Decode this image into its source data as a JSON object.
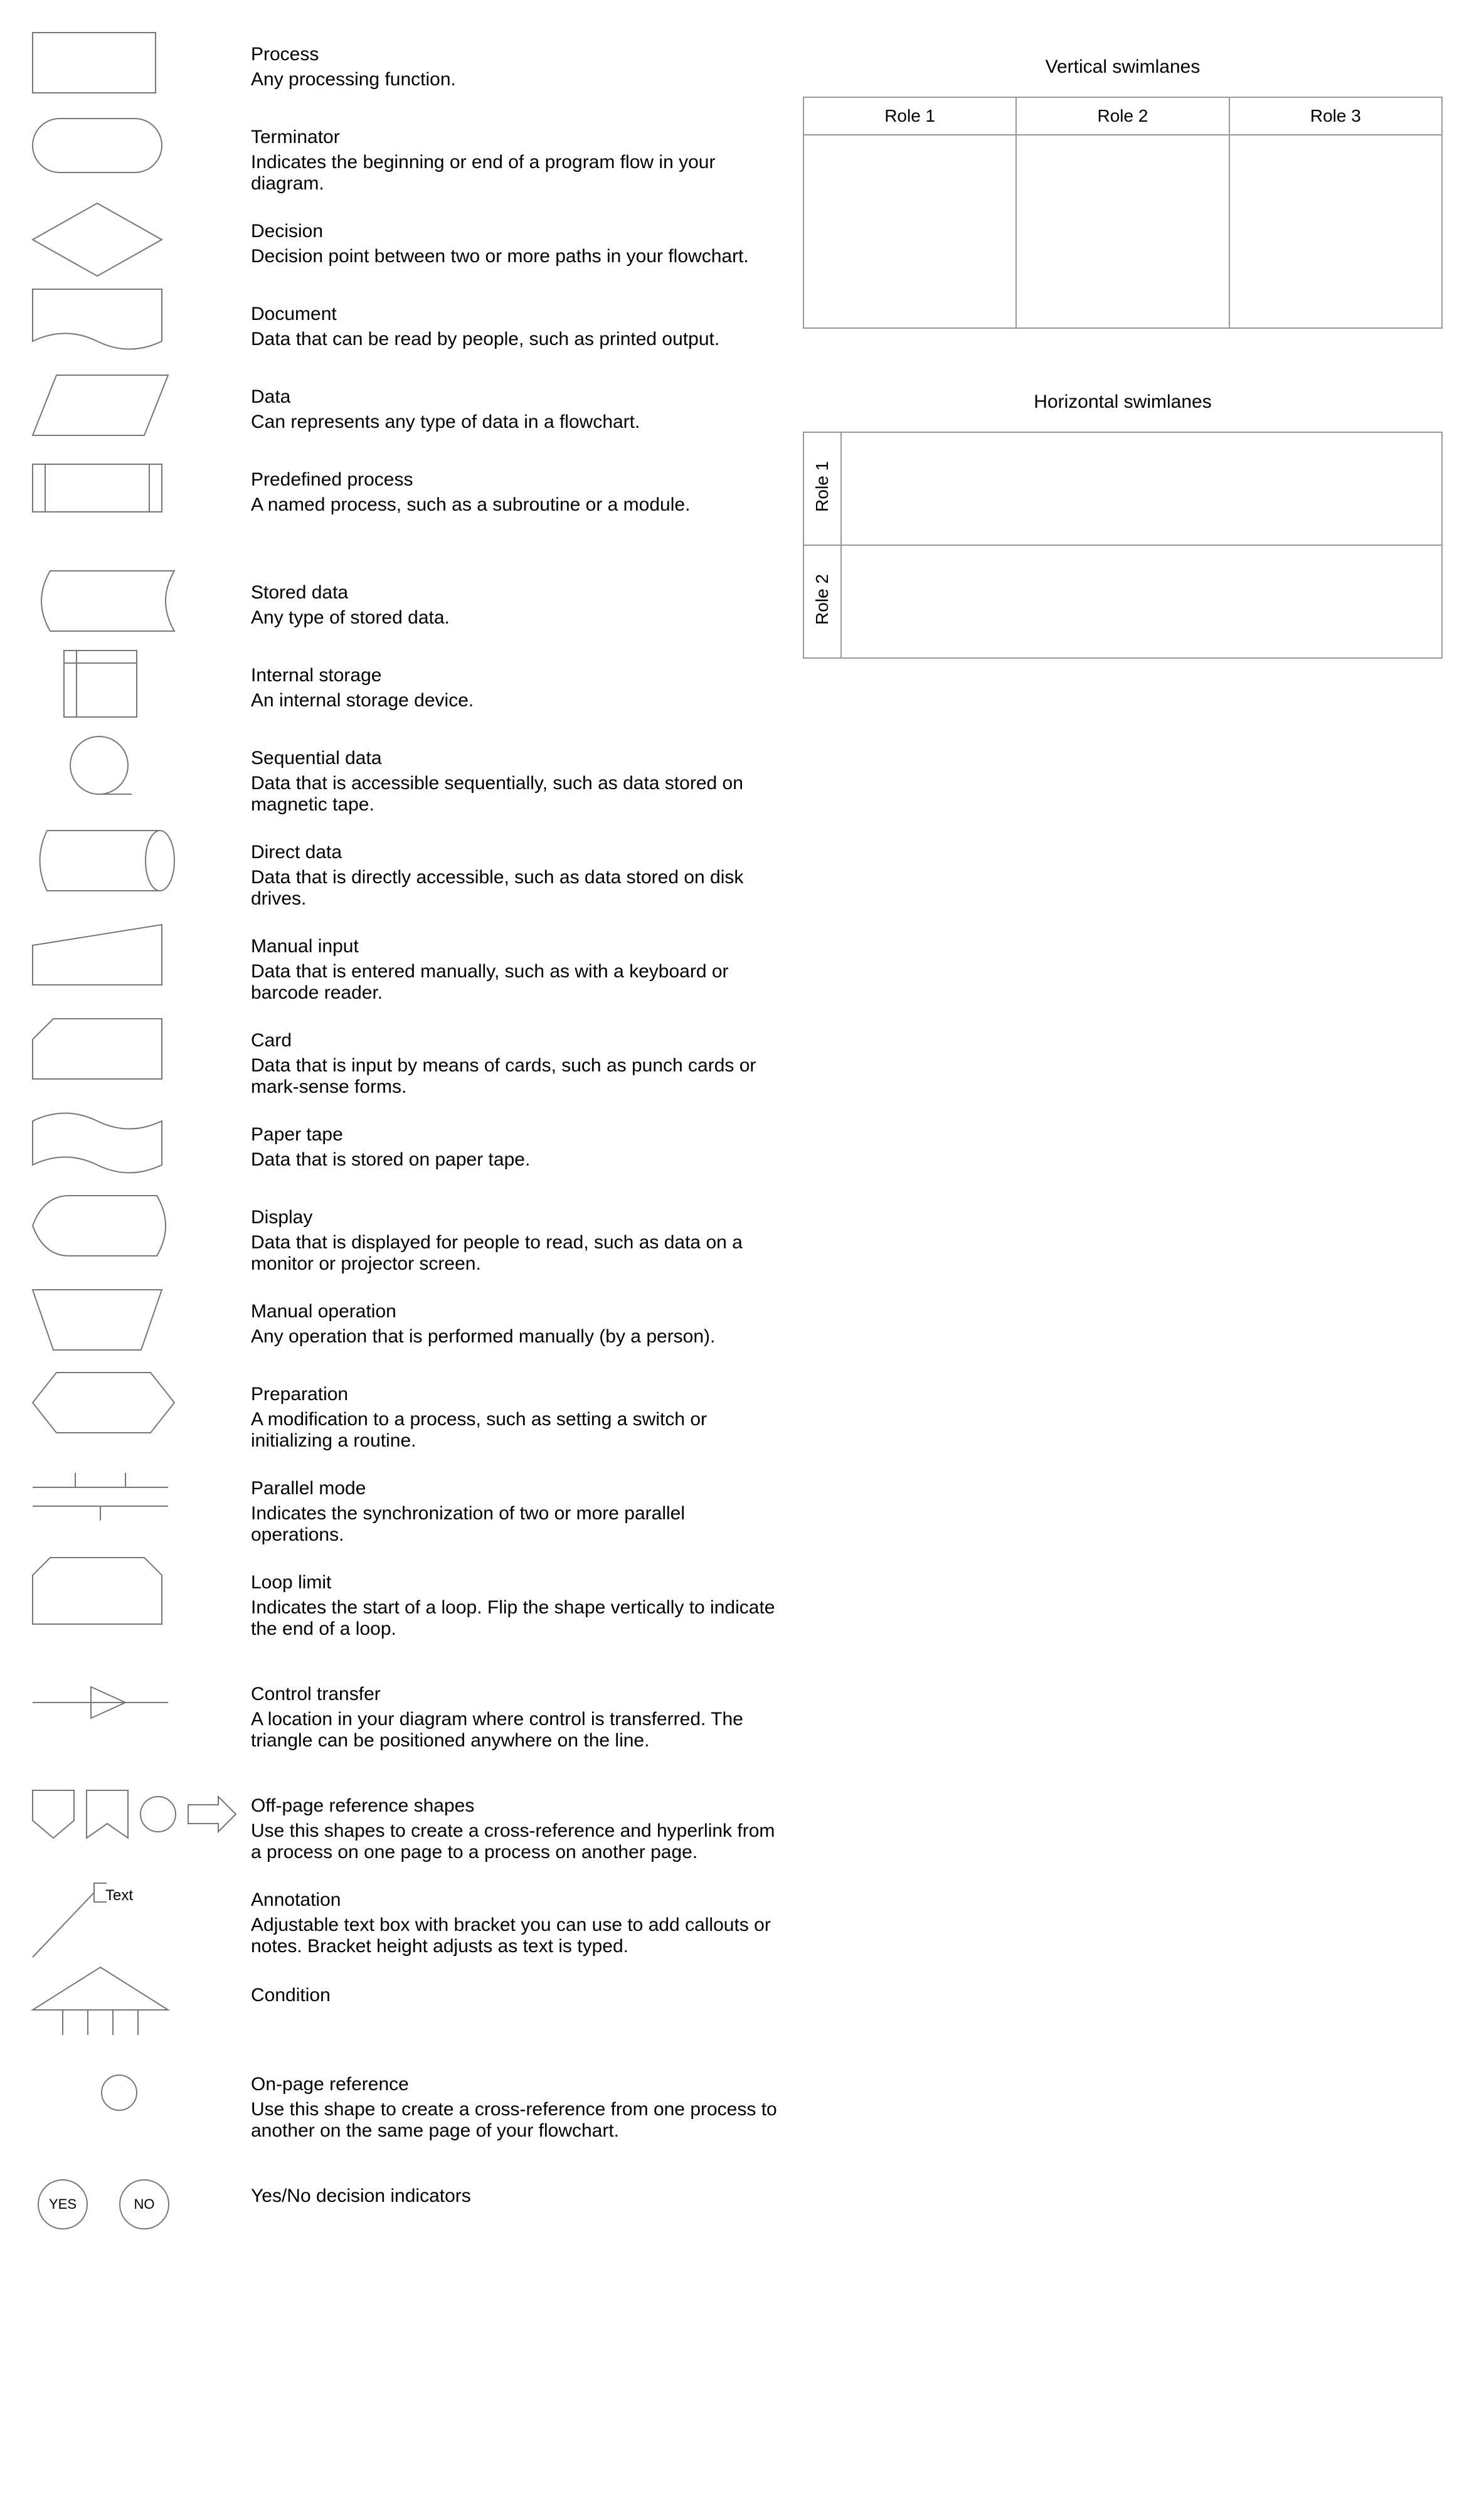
{
  "shapes": [
    {
      "title": "Process",
      "desc": "Any processing function."
    },
    {
      "title": "Terminator",
      "desc": "Indicates the beginning or end of a program flow in your diagram."
    },
    {
      "title": "Decision",
      "desc": "Decision point between two or more paths in your flowchart."
    },
    {
      "title": "Document",
      "desc": "Data that can be read by people, such as printed output."
    },
    {
      "title": "Data",
      "desc": "Can represents any type of data in a flowchart."
    },
    {
      "title": "Predefined process",
      "desc": "A named process, such as a subroutine or a module."
    },
    {
      "title": "Stored data",
      "desc": "Any type of stored data."
    },
    {
      "title": "Internal storage",
      "desc": "An internal storage device."
    },
    {
      "title": "Sequential data",
      "desc": "Data that is accessible sequentially, such as data stored on magnetic tape."
    },
    {
      "title": "Direct data",
      "desc": "Data that is directly accessible, such as data stored on disk drives."
    },
    {
      "title": "Manual input",
      "desc": "Data that is entered manually, such as with a keyboard or barcode reader."
    },
    {
      "title": "Card",
      "desc": "Data that is input by means of cards, such as punch cards or mark-sense forms."
    },
    {
      "title": "Paper tape",
      "desc": "Data that is stored on paper tape."
    },
    {
      "title": "Display",
      "desc": "Data that is displayed for people to read, such as data on a monitor or projector screen."
    },
    {
      "title": "Manual operation",
      "desc": "Any operation that is performed manually (by a person)."
    },
    {
      "title": "Preparation",
      "desc": "A modification to a process, such as setting a switch or initializing a routine."
    },
    {
      "title": "Parallel mode",
      "desc": "Indicates the synchronization of two or more parallel operations."
    },
    {
      "title": "Loop limit",
      "desc": "Indicates the start of a loop. Flip the shape vertically to indicate the end of a loop."
    },
    {
      "title": "Control transfer",
      "desc": "A location in your diagram where control is transferred. The triangle can be positioned anywhere on the line."
    },
    {
      "title": "Off-page reference shapes",
      "desc": "Use this shapes to create a cross-reference and hyperlink from a process on one page to a process on another page."
    },
    {
      "title": "Annotation",
      "desc": "Adjustable text box with bracket you can use to add callouts or notes. Bracket height adjusts as text is typed."
    },
    {
      "title": "Condition",
      "desc": ""
    },
    {
      "title": "On-page reference",
      "desc": "Use this shape to create a cross-reference from one process to another on the same page of your flowchart."
    },
    {
      "title": "Yes/No decision indicators",
      "desc": ""
    }
  ],
  "annotation_label": "Text",
  "yesno": {
    "yes": "YES",
    "no": "NO"
  },
  "swimlanes": {
    "vertical_title": "Vertical swimlanes",
    "horizontal_title": "Horizontal swimlanes",
    "vroles": [
      "Role 1",
      "Role 2",
      "Role 3"
    ],
    "hroles": [
      "Role 1",
      "Role 2"
    ]
  }
}
